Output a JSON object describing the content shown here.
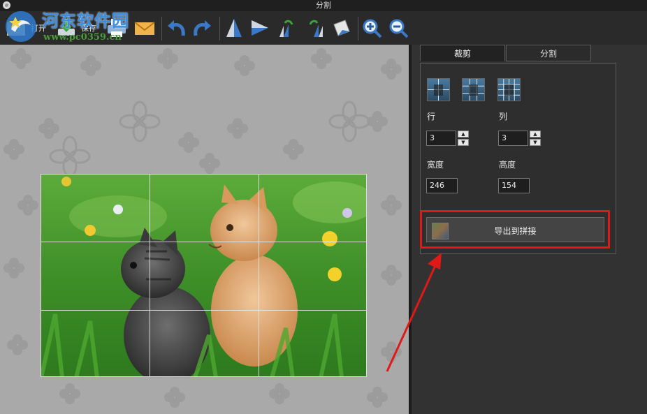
{
  "window": {
    "title": "分割"
  },
  "toolbar": {
    "open_label": "打开",
    "save_label": "保存",
    "icons": [
      "open-icon",
      "save-icon",
      "print-icon",
      "email-icon",
      "undo-icon",
      "redo-icon",
      "flip-vertical-icon",
      "flip-horizontal-icon",
      "rotate-left-icon",
      "rotate-right-icon",
      "skew-icon",
      "zoom-in-icon",
      "zoom-out-icon"
    ]
  },
  "watermark": {
    "title": "河东软件园",
    "url": "www.pc0359.cn"
  },
  "tabs": [
    {
      "label": "裁剪",
      "active": true
    },
    {
      "label": "分割",
      "active": false
    }
  ],
  "split": {
    "rows_label": "行",
    "rows_value": "3",
    "cols_label": "列",
    "cols_value": "3",
    "width_label": "宽度",
    "width_value": "246",
    "height_label": "高度",
    "height_value": "154",
    "export_label": "导出到拼接"
  },
  "colors": {
    "highlight": "#e01818",
    "accent": "#3b8de0"
  }
}
